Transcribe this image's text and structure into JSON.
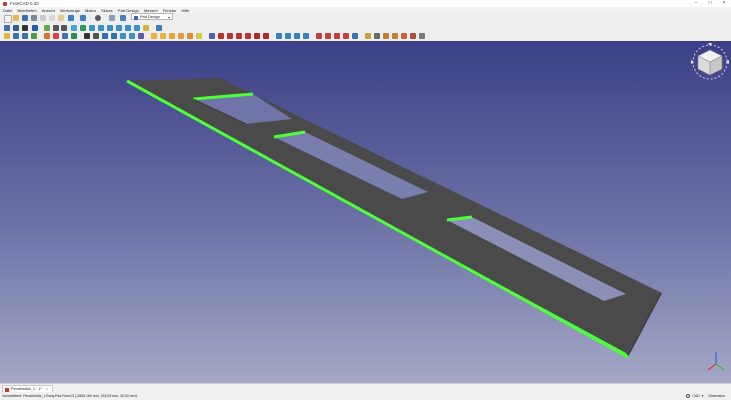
{
  "window": {
    "title": "FreeCAD 0.20",
    "controls": [
      "–",
      "□",
      "×"
    ]
  },
  "menu": [
    "Datei",
    "Bearbeiten",
    "Ansicht",
    "Werkzeuge",
    "Makro",
    "Skizze",
    "Part Design",
    "Messen",
    "Fenster",
    "Hilfe"
  ],
  "workbench": {
    "selected": "Part Design",
    "icon": "part-design-icon"
  },
  "tabs": [
    {
      "label": "Pendelstütz_1 : 1*",
      "icon": "freecad-document-icon",
      "close": "×"
    }
  ],
  "status": {
    "message": "Vorselektiert: Pendelstütz_1.Body.Pad.Face13 (-2805.169 mm, 216.09 mm, 26.00 mm)",
    "navigation_style": "CAD",
    "units": "Dimension"
  },
  "colors": {
    "viewport_top": "#3b3f86",
    "viewport_bottom": "#a5a8c6",
    "part_face": "#4a4a4a",
    "highlight": "#4cff3c"
  },
  "icons": {
    "navcube": "navigation-cube-icon",
    "axis": "axis-cross-icon"
  }
}
